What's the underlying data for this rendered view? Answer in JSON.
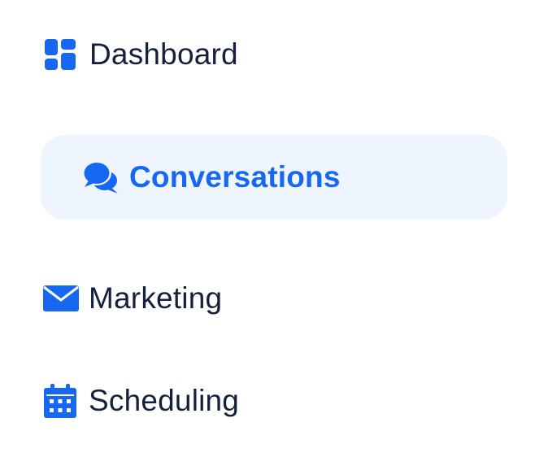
{
  "sidebar": {
    "items": [
      {
        "label": "Dashboard",
        "icon": "dashboard-grid-icon",
        "active": false
      },
      {
        "label": "Conversations",
        "icon": "chat-bubbles-icon",
        "active": true
      },
      {
        "label": "Marketing",
        "icon": "envelope-icon",
        "active": false
      },
      {
        "label": "Scheduling",
        "icon": "calendar-icon",
        "active": false
      }
    ]
  },
  "colors": {
    "accent": "#1768f0",
    "text": "#14213d",
    "active_background": "#eef5fe",
    "background": "#ffffff"
  }
}
